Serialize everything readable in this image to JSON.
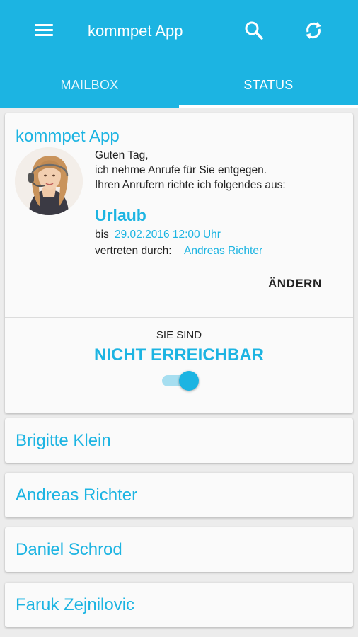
{
  "app_bar": {
    "title": "kommpet App",
    "icons": {
      "menu": "menu-icon",
      "search": "search-icon",
      "refresh": "refresh-icon"
    },
    "background_color": "#1cb4e2"
  },
  "tabs": [
    {
      "label": "MAILBOX",
      "selected": false
    },
    {
      "label": "STATUS",
      "selected": true
    }
  ],
  "status_card": {
    "heading": "kommpet App",
    "avatar": "operator-avatar",
    "message_lines": [
      "Guten Tag,",
      "ich nehme Anrufe für Sie entgegen.",
      "Ihren Anrufern richte ich folgendes aus:"
    ],
    "absence_type": "Urlaub",
    "until_label": "bis",
    "until_value": "29.02.2016 12:00 Uhr",
    "deputy_label": "vertreten durch:",
    "deputy_value": "Andreas Richter",
    "change_button": "ÄNDERN",
    "reachability_label": "SIE SIND",
    "reachability_status": "NICHT ERREICHBAR",
    "toggle_on": true
  },
  "contacts": [
    {
      "name": "Brigitte Klein"
    },
    {
      "name": "Andreas Richter"
    },
    {
      "name": "Daniel Schrod"
    },
    {
      "name": "Faruk Zejnilovic"
    }
  ],
  "colors": {
    "accent": "#1cb4e2",
    "background": "#ececec",
    "card": "#fafafa"
  }
}
